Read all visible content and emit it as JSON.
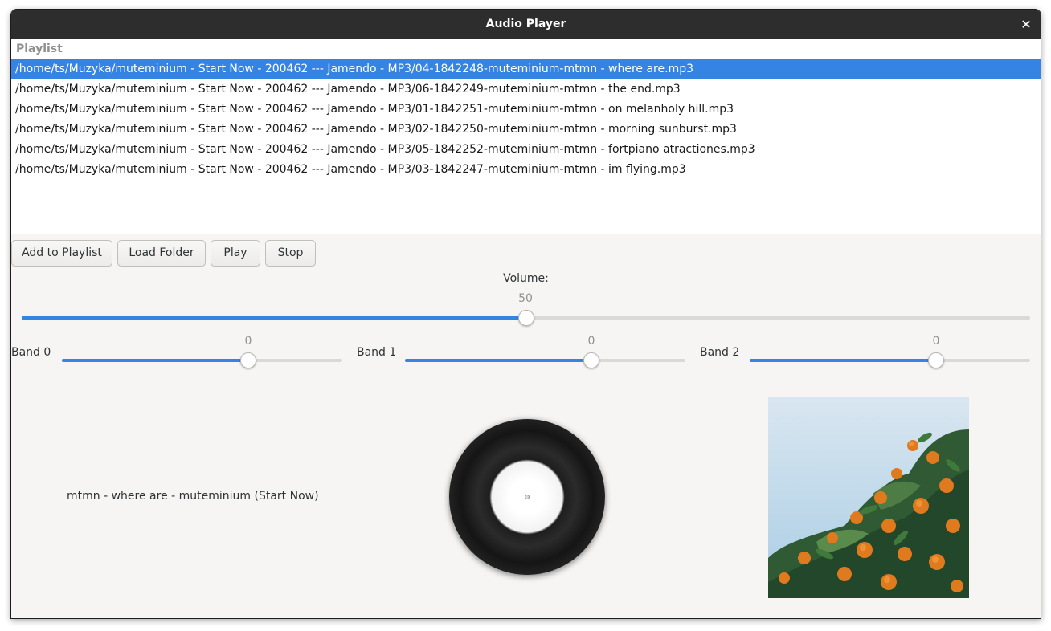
{
  "window": {
    "title": "Audio Player",
    "close_icon": "close-icon"
  },
  "playlist": {
    "header": "Playlist",
    "selected_index": 0,
    "items": [
      "/home/ts/Muzyka/muteminium - Start Now - 200462 --- Jamendo - MP3/04-1842248-muteminium-mtmn - where are.mp3",
      "/home/ts/Muzyka/muteminium - Start Now - 200462 --- Jamendo - MP3/06-1842249-muteminium-mtmn - the end.mp3",
      "/home/ts/Muzyka/muteminium - Start Now - 200462 --- Jamendo - MP3/01-1842251-muteminium-mtmn - on melanholy hill.mp3",
      "/home/ts/Muzyka/muteminium - Start Now - 200462 --- Jamendo - MP3/02-1842250-muteminium-mtmn - morning sunburst.mp3",
      "/home/ts/Muzyka/muteminium - Start Now - 200462 --- Jamendo - MP3/05-1842252-muteminium-mtmn - fortpiano atractiones.mp3",
      "/home/ts/Muzyka/muteminium - Start Now - 200462 --- Jamendo - MP3/03-1842247-muteminium-mtmn - im flying.mp3"
    ]
  },
  "toolbar": {
    "add_label": "Add to Playlist",
    "load_label": "Load Folder",
    "play_label": "Play",
    "stop_label": "Stop"
  },
  "volume": {
    "label": "Volume:",
    "value": "50",
    "fraction": 0.5
  },
  "bands": [
    {
      "label": "Band 0",
      "value": "0",
      "fraction": 0.666
    },
    {
      "label": "Band 1",
      "value": "0",
      "fraction": 0.666
    },
    {
      "label": "Band 2",
      "value": "0",
      "fraction": 0.666
    }
  ],
  "now_playing": {
    "track": "mtmn - where are - muteminium (Start Now)",
    "disc_icon": "vinyl-record-icon",
    "cover": "album-cover-orange-tree"
  },
  "colors": {
    "accent": "#3584e4",
    "titlebar": "#2d2d2d"
  }
}
